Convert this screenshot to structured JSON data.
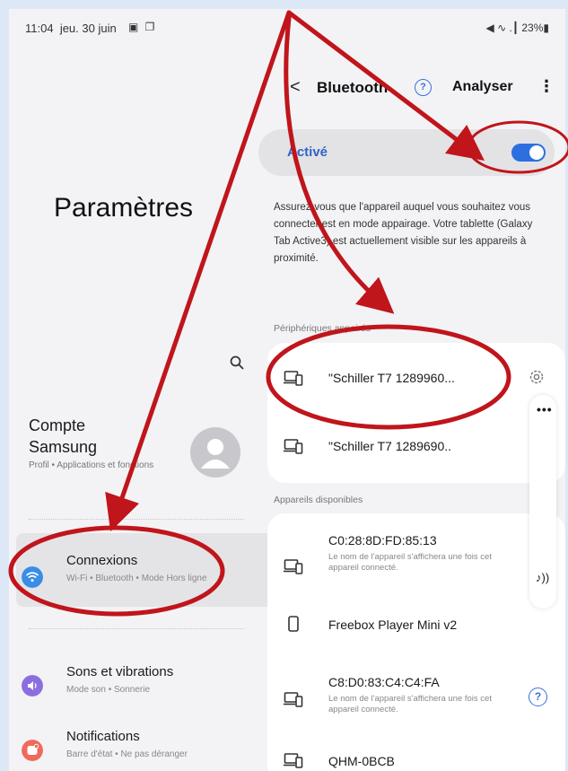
{
  "status_bar": {
    "time": "11:04",
    "date": "jeu. 30 juin",
    "left_icons": "▣ ❐",
    "right_text": "◀ ∿ .┃ 23%▮"
  },
  "left_panel": {
    "title": "Paramètres",
    "account": {
      "title": "Compte Samsung",
      "subtitle": "Profil • Applications et fonctions"
    },
    "items": [
      {
        "label": "Connexions",
        "subtitle": "Wi-Fi • Bluetooth • Mode Hors ligne",
        "icon": "wifi-icon",
        "color": "#3a8de6",
        "active": true
      },
      {
        "label": "Sons et vibrations",
        "subtitle": "Mode son • Sonnerie",
        "icon": "sound-icon",
        "color": "#8b6fe0",
        "active": false
      },
      {
        "label": "Notifications",
        "subtitle": "Barre d'état • Ne pas déranger",
        "icon": "notification-icon",
        "color": "#ef6a5b",
        "active": false
      }
    ]
  },
  "bluetooth": {
    "title": "Bluetooth",
    "scan_label": "Analyser",
    "more_label": "⋮",
    "back_label": "<",
    "help_label": "?",
    "toggle_label": "Activé",
    "toggle_on": true,
    "info": "Assurez-vous que l'appareil auquel vous souhaitez vous connecter est en mode appairage. Votre tablette (Galaxy Tab Active3) est actuellement visible sur les appareils à proximité.",
    "paired_label": "Périphériques appairés",
    "paired": [
      {
        "name": "\"Schiller T7 1289960..."
      },
      {
        "name": "\"Schiller T7 1289690.."
      }
    ],
    "available_label": "Appareils disponibles",
    "available": [
      {
        "name": "C0:28:8D:FD:85:13",
        "note": "Le nom de l'appareil s'affichera une fois cet appareil connecté."
      },
      {
        "name": "Freebox Player Mini v2",
        "note": ""
      },
      {
        "name": "C8:D0:83:C4:C4:FA",
        "note": "Le nom de l'appareil s'affichera une fois cet appareil connecté."
      },
      {
        "name": "QHM-0BCB",
        "note": ""
      }
    ],
    "side_panel_dots": "•••",
    "side_panel_sound": "♪))"
  },
  "colors": {
    "accent": "#2e6fe0",
    "annotation": "#c0151b"
  }
}
